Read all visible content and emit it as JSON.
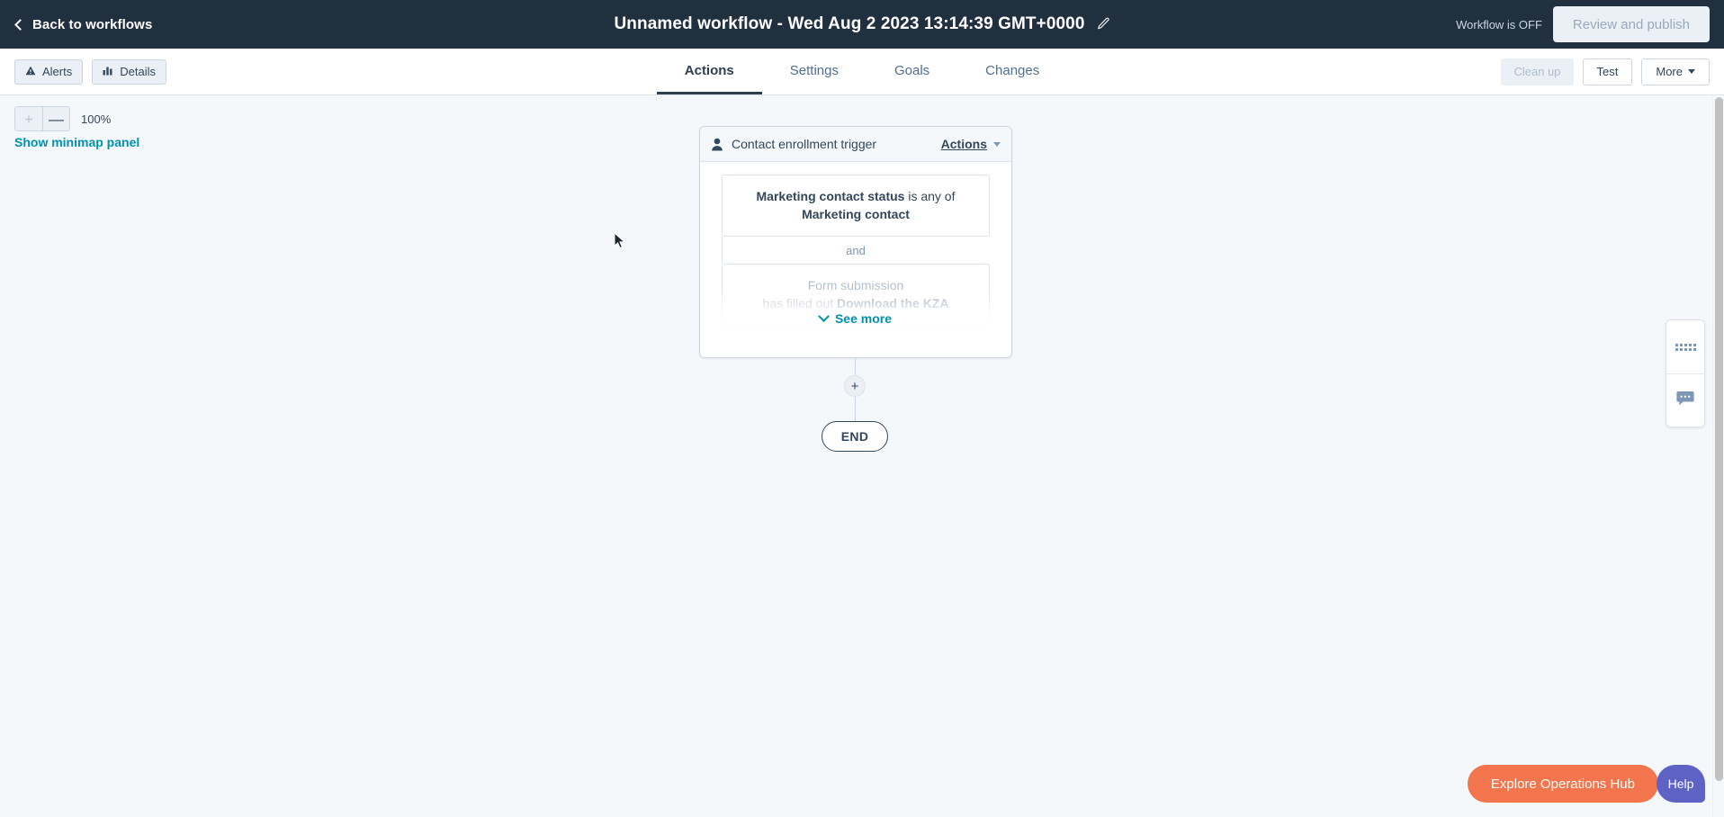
{
  "topbar": {
    "back_label": "Back to workflows",
    "title": "Unnamed workflow - Wed Aug 2 2023 13:14:39 GMT+0000",
    "edit_icon": "pencil-icon",
    "status_text": "Workflow is OFF",
    "publish_label": "Review and publish"
  },
  "navbar": {
    "left_buttons": [
      {
        "label": "Alerts",
        "icon": "warning-triangle-icon"
      },
      {
        "label": "Details",
        "icon": "bar-chart-icon"
      }
    ],
    "tabs": [
      {
        "label": "Actions",
        "active": true
      },
      {
        "label": "Settings",
        "active": false
      },
      {
        "label": "Goals",
        "active": false
      },
      {
        "label": "Changes",
        "active": false
      }
    ],
    "right_buttons": [
      {
        "label": "Clean up",
        "disabled": true
      },
      {
        "label": "Test",
        "disabled": false
      },
      {
        "label": "More",
        "disabled": false,
        "caret": true
      }
    ]
  },
  "canvas": {
    "zoom": {
      "zoom_in_label": "+",
      "zoom_out_label": "—",
      "level_label": "100%"
    },
    "minimap_link": "Show minimap panel"
  },
  "trigger_card": {
    "header": {
      "icon": "contact-person-icon",
      "title": "Contact enrollment trigger",
      "actions_label": "Actions"
    },
    "filters": [
      {
        "prefix_bold": "Marketing contact status",
        "middle": " is any of ",
        "suffix_bold": "Marketing contact",
        "faded": false
      }
    ],
    "separator_label": "and",
    "faded_filter": {
      "line1": "Form submission",
      "line2_prefix": "has filled out ",
      "line2_bold": "Download the KZA"
    },
    "see_more_label": "See more"
  },
  "flow": {
    "add_step_label": "+",
    "end_label": "END"
  },
  "side_panel": {
    "items": [
      {
        "icon": "dot-grid-icon",
        "name": "apps-grid"
      },
      {
        "icon": "chat-bubble-icon",
        "name": "comments"
      }
    ]
  },
  "footer": {
    "ops_hub_label": "Explore Operations Hub",
    "help_label": "Help"
  },
  "colors": {
    "header_bg": "#21303f",
    "canvas_bg": "#f5f8fa",
    "link_teal": "#0091ae",
    "ops_hub_orange": "#f2754d",
    "help_purple": "#5e62c5",
    "border": "#cbd6e2",
    "text_dark": "#33475b"
  }
}
